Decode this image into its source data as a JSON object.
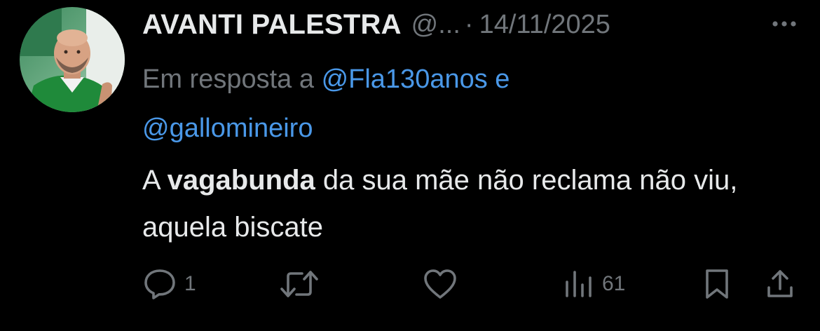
{
  "tweet": {
    "display_name": "AVANTI PALESTRA",
    "handle": "@...",
    "separator": "·",
    "timestamp": "14/11/2025",
    "reply_prefix": "Em resposta a",
    "reply_mention_1": "@Fla130anos",
    "reply_conjunction": "e",
    "reply_mention_2": "@gallomineiro",
    "text_part_1": "A",
    "text_bold": "vagabunda",
    "text_part_2": "da sua mãe não reclama não viu, aquela biscate"
  },
  "actions": {
    "reply_count": "1",
    "retweet_count": "",
    "like_count": "",
    "views_count": "61"
  },
  "colors": {
    "background": "#000000",
    "primary_text": "#e7e9ea",
    "secondary_text": "#71767b",
    "link": "#4a98e8"
  },
  "icons": {
    "more": "more-horizontal-icon",
    "reply": "reply-bubble-icon",
    "retweet": "retweet-icon",
    "like": "heart-icon",
    "views": "views-bar-chart-icon",
    "bookmark": "bookmark-icon",
    "share": "share-upload-icon"
  }
}
